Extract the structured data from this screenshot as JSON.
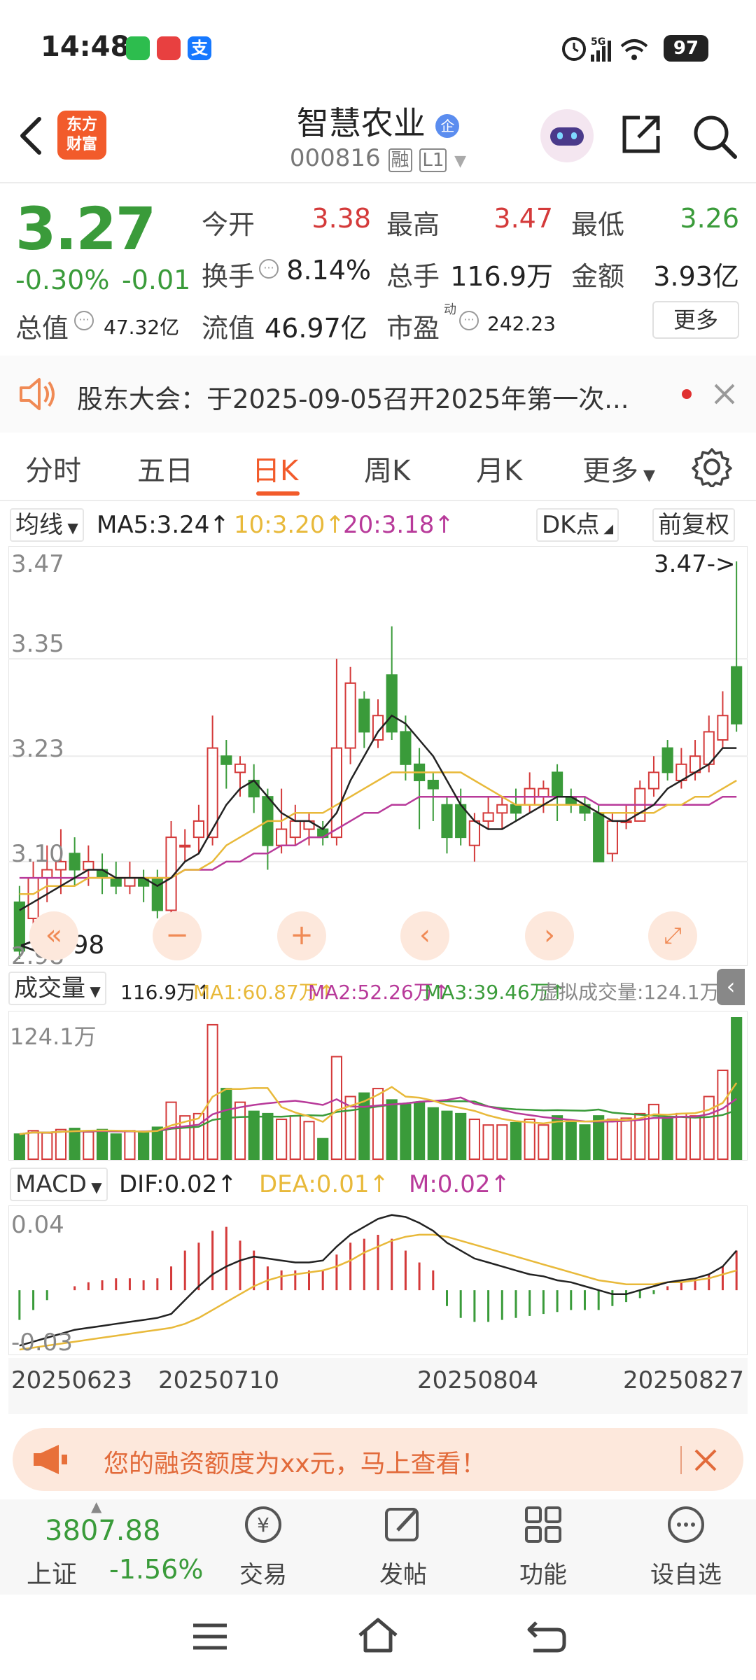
{
  "status": {
    "time": "14:48",
    "network": "5G",
    "battery": "97"
  },
  "header": {
    "logo_text_1": "东方",
    "logo_text_2": "财富",
    "title": "智慧农业",
    "title_badge": "企",
    "code": "000816",
    "tag_margin": "融",
    "tag_level": "L1"
  },
  "quote": {
    "price": "3.27",
    "change_pct": "-0.30%",
    "change": "-0.01",
    "open_label": "今开",
    "open": "3.38",
    "high_label": "最高",
    "high": "3.47",
    "low_label": "最低",
    "low": "3.26",
    "turnover_label": "换手",
    "turnover": "8.14%",
    "volume_label": "总手",
    "volume": "116.9万",
    "amount_label": "金额",
    "amount": "3.93亿",
    "mktcap_label": "总值",
    "mktcap": "47.32亿",
    "float_label": "流值",
    "float": "46.97亿",
    "pe_label": "市盈",
    "pe_sup": "动",
    "pe": "242.23",
    "more": "更多"
  },
  "notice": {
    "text": "股东大会：于2025-09-05召开2025年第一次..."
  },
  "tabs": [
    {
      "label": "分时"
    },
    {
      "label": "五日"
    },
    {
      "label": "日K"
    },
    {
      "label": "周K"
    },
    {
      "label": "月K"
    },
    {
      "label": "更多"
    }
  ],
  "ma_legend": {
    "selector": "均线",
    "ma5": "MA5:3.24",
    "ma10": "10:3.20",
    "ma20": "20:3.18",
    "dk": "DK点",
    "adjust": "前复权"
  },
  "price_axis": {
    "top": "3.47",
    "mid1": "3.35",
    "mid2": "3.23",
    "mid3": "3.10",
    "bottom": "2.98",
    "max_marker": "3.47->",
    "min_marker": "<-2.98"
  },
  "vol_legend": {
    "selector": "成交量",
    "current": "116.9万",
    "ma1": "MA1:60.87万",
    "ma2": "MA2:52.26万",
    "ma3": "MA3:39.46万",
    "virtual": "虚拟成交量:124.1万",
    "axis_top": "124.1万"
  },
  "macd_legend": {
    "selector": "MACD",
    "dif": "DIF:0.02",
    "dea": "DEA:0.01",
    "m": "M:0.02",
    "axis_top": "0.04",
    "axis_bottom": "-0.03"
  },
  "dates": [
    "20250623",
    "20250710",
    "20250804",
    "20250827"
  ],
  "banner": {
    "text": "您的融资额度为xx元，马上查看！"
  },
  "bottom_nav": {
    "index_value": "3807.88",
    "index_name": "上证",
    "index_change": "-1.56%",
    "items": [
      {
        "label": "交易"
      },
      {
        "label": "发帖"
      },
      {
        "label": "功能"
      },
      {
        "label": "设自选"
      }
    ]
  },
  "colors": {
    "up": "#d43a3a",
    "down": "#3a9b3a",
    "accent": "#f25b2b",
    "ma5": "#222222",
    "ma10": "#e8b93a",
    "ma20": "#b83a9a"
  },
  "chart_data": {
    "type": "candlestick",
    "ylim": [
      2.98,
      3.47
    ],
    "candles": [
      {
        "o": 3.05,
        "c": 2.99,
        "h": 3.07,
        "l": 2.98
      },
      {
        "o": 3.03,
        "c": 3.08,
        "h": 3.1,
        "l": 3.01
      },
      {
        "o": 3.08,
        "c": 3.09,
        "h": 3.12,
        "l": 3.05
      },
      {
        "o": 3.09,
        "c": 3.1,
        "h": 3.14,
        "l": 3.06
      },
      {
        "o": 3.11,
        "c": 3.09,
        "h": 3.13,
        "l": 3.07
      },
      {
        "o": 3.09,
        "c": 3.1,
        "h": 3.12,
        "l": 3.07
      },
      {
        "o": 3.09,
        "c": 3.08,
        "h": 3.11,
        "l": 3.06
      },
      {
        "o": 3.08,
        "c": 3.07,
        "h": 3.1,
        "l": 3.06
      },
      {
        "o": 3.07,
        "c": 3.08,
        "h": 3.1,
        "l": 3.06
      },
      {
        "o": 3.08,
        "c": 3.07,
        "h": 3.09,
        "l": 3.05
      },
      {
        "o": 3.08,
        "c": 3.04,
        "h": 3.09,
        "l": 3.03
      },
      {
        "o": 3.04,
        "c": 3.13,
        "h": 3.15,
        "l": 3.03
      },
      {
        "o": 3.12,
        "c": 3.12,
        "h": 3.14,
        "l": 3.1
      },
      {
        "o": 3.13,
        "c": 3.15,
        "h": 3.17,
        "l": 3.11
      },
      {
        "o": 3.13,
        "c": 3.24,
        "h": 3.28,
        "l": 3.12
      },
      {
        "o": 3.23,
        "c": 3.22,
        "h": 3.25,
        "l": 3.19
      },
      {
        "o": 3.21,
        "c": 3.22,
        "h": 3.23,
        "l": 3.18
      },
      {
        "o": 3.2,
        "c": 3.18,
        "h": 3.22,
        "l": 3.16
      },
      {
        "o": 3.18,
        "c": 3.12,
        "h": 3.19,
        "l": 3.09
      },
      {
        "o": 3.12,
        "c": 3.14,
        "h": 3.19,
        "l": 3.11
      },
      {
        "o": 3.13,
        "c": 3.15,
        "h": 3.17,
        "l": 3.12
      },
      {
        "o": 3.14,
        "c": 3.15,
        "h": 3.16,
        "l": 3.12
      },
      {
        "o": 3.14,
        "c": 3.13,
        "h": 3.15,
        "l": 3.12
      },
      {
        "o": 3.13,
        "c": 3.24,
        "h": 3.35,
        "l": 3.12
      },
      {
        "o": 3.24,
        "c": 3.32,
        "h": 3.34,
        "l": 3.22
      },
      {
        "o": 3.3,
        "c": 3.26,
        "h": 3.31,
        "l": 3.24
      },
      {
        "o": 3.25,
        "c": 3.28,
        "h": 3.3,
        "l": 3.24
      },
      {
        "o": 3.33,
        "c": 3.26,
        "h": 3.39,
        "l": 3.25
      },
      {
        "o": 3.26,
        "c": 3.22,
        "h": 3.28,
        "l": 3.2
      },
      {
        "o": 3.22,
        "c": 3.2,
        "h": 3.24,
        "l": 3.14
      },
      {
        "o": 3.2,
        "c": 3.19,
        "h": 3.21,
        "l": 3.15
      },
      {
        "o": 3.17,
        "c": 3.13,
        "h": 3.18,
        "l": 3.11
      },
      {
        "o": 3.17,
        "c": 3.13,
        "h": 3.19,
        "l": 3.12
      },
      {
        "o": 3.12,
        "c": 3.15,
        "h": 3.16,
        "l": 3.1
      },
      {
        "o": 3.15,
        "c": 3.16,
        "h": 3.18,
        "l": 3.14
      },
      {
        "o": 3.16,
        "c": 3.17,
        "h": 3.18,
        "l": 3.14
      },
      {
        "o": 3.17,
        "c": 3.16,
        "h": 3.19,
        "l": 3.15
      },
      {
        "o": 3.17,
        "c": 3.19,
        "h": 3.21,
        "l": 3.16
      },
      {
        "o": 3.18,
        "c": 3.19,
        "h": 3.2,
        "l": 3.16
      },
      {
        "o": 3.21,
        "c": 3.18,
        "h": 3.22,
        "l": 3.15
      },
      {
        "o": 3.18,
        "c": 3.17,
        "h": 3.19,
        "l": 3.16
      },
      {
        "o": 3.17,
        "c": 3.16,
        "h": 3.18,
        "l": 3.15
      },
      {
        "o": 3.16,
        "c": 3.1,
        "h": 3.17,
        "l": 3.1
      },
      {
        "o": 3.11,
        "c": 3.15,
        "h": 3.16,
        "l": 3.1
      },
      {
        "o": 3.15,
        "c": 3.15,
        "h": 3.17,
        "l": 3.14
      },
      {
        "o": 3.15,
        "c": 3.19,
        "h": 3.2,
        "l": 3.15
      },
      {
        "o": 3.19,
        "c": 3.21,
        "h": 3.23,
        "l": 3.18
      },
      {
        "o": 3.24,
        "c": 3.21,
        "h": 3.25,
        "l": 3.2
      },
      {
        "o": 3.2,
        "c": 3.22,
        "h": 3.24,
        "l": 3.19
      },
      {
        "o": 3.21,
        "c": 3.23,
        "h": 3.25,
        "l": 3.2
      },
      {
        "o": 3.22,
        "c": 3.26,
        "h": 3.28,
        "l": 3.21
      },
      {
        "o": 3.25,
        "c": 3.28,
        "h": 3.31,
        "l": 3.24
      },
      {
        "o": 3.34,
        "c": 3.27,
        "h": 3.47,
        "l": 3.26
      }
    ],
    "ma5": [
      3.04,
      3.05,
      3.06,
      3.07,
      3.08,
      3.09,
      3.09,
      3.08,
      3.08,
      3.08,
      3.07,
      3.08,
      3.1,
      3.11,
      3.14,
      3.17,
      3.19,
      3.2,
      3.18,
      3.16,
      3.15,
      3.15,
      3.14,
      3.16,
      3.2,
      3.23,
      3.26,
      3.28,
      3.27,
      3.25,
      3.23,
      3.2,
      3.17,
      3.15,
      3.14,
      3.14,
      3.15,
      3.16,
      3.17,
      3.18,
      3.18,
      3.17,
      3.16,
      3.15,
      3.15,
      3.16,
      3.17,
      3.19,
      3.2,
      3.21,
      3.22,
      3.24,
      3.24
    ],
    "ma10": [
      3.06,
      3.06,
      3.07,
      3.07,
      3.07,
      3.08,
      3.08,
      3.08,
      3.08,
      3.08,
      3.08,
      3.08,
      3.09,
      3.09,
      3.1,
      3.12,
      3.13,
      3.14,
      3.15,
      3.15,
      3.16,
      3.16,
      3.16,
      3.17,
      3.18,
      3.19,
      3.2,
      3.21,
      3.21,
      3.21,
      3.21,
      3.21,
      3.21,
      3.2,
      3.19,
      3.18,
      3.17,
      3.17,
      3.17,
      3.17,
      3.17,
      3.17,
      3.16,
      3.16,
      3.16,
      3.16,
      3.16,
      3.17,
      3.17,
      3.18,
      3.18,
      3.19,
      3.2
    ],
    "ma20": [
      3.08,
      3.08,
      3.08,
      3.08,
      3.08,
      3.08,
      3.08,
      3.08,
      3.08,
      3.08,
      3.08,
      3.08,
      3.09,
      3.09,
      3.09,
      3.1,
      3.1,
      3.11,
      3.11,
      3.12,
      3.12,
      3.13,
      3.13,
      3.14,
      3.15,
      3.16,
      3.16,
      3.17,
      3.17,
      3.18,
      3.18,
      3.18,
      3.18,
      3.18,
      3.18,
      3.18,
      3.18,
      3.18,
      3.18,
      3.18,
      3.18,
      3.18,
      3.17,
      3.17,
      3.17,
      3.17,
      3.17,
      3.17,
      3.17,
      3.17,
      3.17,
      3.18,
      3.18
    ],
    "volume_ylim": [
      0,
      124.1
    ],
    "volume": [
      22,
      25,
      23,
      26,
      27,
      24,
      26,
      22,
      25,
      23,
      28,
      50,
      38,
      40,
      118,
      62,
      50,
      42,
      40,
      35,
      38,
      33,
      18,
      90,
      55,
      58,
      62,
      52,
      48,
      50,
      45,
      42,
      40,
      35,
      30,
      30,
      32,
      35,
      30,
      38,
      32,
      30,
      38,
      35,
      36,
      40,
      48,
      36,
      40,
      38,
      55,
      78,
      124.1
    ],
    "macd_ylim": [
      -0.03,
      0.04
    ],
    "macd_hist": [
      -0.015,
      -0.01,
      -0.005,
      0.0,
      0.002,
      0.004,
      0.005,
      0.006,
      0.006,
      0.005,
      0.006,
      0.012,
      0.02,
      0.024,
      0.03,
      0.032,
      0.025,
      0.02,
      0.012,
      0.01,
      0.01,
      0.01,
      0.01,
      0.018,
      0.024,
      0.026,
      0.028,
      0.026,
      0.02,
      0.014,
      0.01,
      -0.008,
      -0.014,
      -0.016,
      -0.016,
      -0.015,
      -0.014,
      -0.013,
      -0.012,
      -0.011,
      -0.01,
      -0.01,
      -0.01,
      -0.008,
      -0.006,
      -0.004,
      -0.002,
      0.002,
      0.004,
      0.006,
      0.008,
      0.012,
      0.02
    ],
    "dif": [
      -0.028,
      -0.026,
      -0.024,
      -0.022,
      -0.02,
      -0.019,
      -0.018,
      -0.017,
      -0.016,
      -0.015,
      -0.014,
      -0.012,
      -0.005,
      0.002,
      0.008,
      0.012,
      0.015,
      0.017,
      0.016,
      0.015,
      0.014,
      0.014,
      0.015,
      0.022,
      0.028,
      0.032,
      0.036,
      0.038,
      0.037,
      0.034,
      0.03,
      0.024,
      0.02,
      0.016,
      0.014,
      0.012,
      0.01,
      0.008,
      0.007,
      0.005,
      0.004,
      0.002,
      0.0,
      -0.002,
      -0.002,
      0.0,
      0.002,
      0.004,
      0.005,
      0.006,
      0.008,
      0.012,
      0.02
    ],
    "dea": [
      -0.03,
      -0.029,
      -0.028,
      -0.027,
      -0.026,
      -0.025,
      -0.024,
      -0.023,
      -0.022,
      -0.021,
      -0.02,
      -0.019,
      -0.017,
      -0.014,
      -0.01,
      -0.006,
      -0.002,
      0.002,
      0.005,
      0.007,
      0.008,
      0.009,
      0.01,
      0.012,
      0.015,
      0.019,
      0.022,
      0.025,
      0.027,
      0.028,
      0.028,
      0.027,
      0.025,
      0.023,
      0.021,
      0.019,
      0.017,
      0.015,
      0.013,
      0.011,
      0.009,
      0.007,
      0.005,
      0.004,
      0.003,
      0.003,
      0.003,
      0.004,
      0.004,
      0.005,
      0.006,
      0.008,
      0.01
    ]
  }
}
